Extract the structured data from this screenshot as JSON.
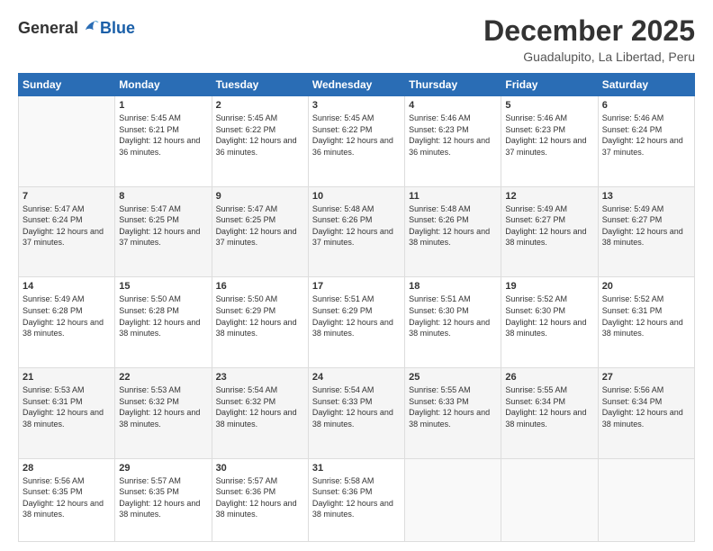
{
  "logo": {
    "general": "General",
    "blue": "Blue"
  },
  "header": {
    "title": "December 2025",
    "subtitle": "Guadalupito, La Libertad, Peru"
  },
  "days_of_week": [
    "Sunday",
    "Monday",
    "Tuesday",
    "Wednesday",
    "Thursday",
    "Friday",
    "Saturday"
  ],
  "weeks": [
    [
      {
        "day": "",
        "sunrise": "",
        "sunset": "",
        "daylight": ""
      },
      {
        "day": "1",
        "sunrise": "Sunrise: 5:45 AM",
        "sunset": "Sunset: 6:21 PM",
        "daylight": "Daylight: 12 hours and 36 minutes."
      },
      {
        "day": "2",
        "sunrise": "Sunrise: 5:45 AM",
        "sunset": "Sunset: 6:22 PM",
        "daylight": "Daylight: 12 hours and 36 minutes."
      },
      {
        "day": "3",
        "sunrise": "Sunrise: 5:45 AM",
        "sunset": "Sunset: 6:22 PM",
        "daylight": "Daylight: 12 hours and 36 minutes."
      },
      {
        "day": "4",
        "sunrise": "Sunrise: 5:46 AM",
        "sunset": "Sunset: 6:23 PM",
        "daylight": "Daylight: 12 hours and 36 minutes."
      },
      {
        "day": "5",
        "sunrise": "Sunrise: 5:46 AM",
        "sunset": "Sunset: 6:23 PM",
        "daylight": "Daylight: 12 hours and 37 minutes."
      },
      {
        "day": "6",
        "sunrise": "Sunrise: 5:46 AM",
        "sunset": "Sunset: 6:24 PM",
        "daylight": "Daylight: 12 hours and 37 minutes."
      }
    ],
    [
      {
        "day": "7",
        "sunrise": "Sunrise: 5:47 AM",
        "sunset": "Sunset: 6:24 PM",
        "daylight": "Daylight: 12 hours and 37 minutes."
      },
      {
        "day": "8",
        "sunrise": "Sunrise: 5:47 AM",
        "sunset": "Sunset: 6:25 PM",
        "daylight": "Daylight: 12 hours and 37 minutes."
      },
      {
        "day": "9",
        "sunrise": "Sunrise: 5:47 AM",
        "sunset": "Sunset: 6:25 PM",
        "daylight": "Daylight: 12 hours and 37 minutes."
      },
      {
        "day": "10",
        "sunrise": "Sunrise: 5:48 AM",
        "sunset": "Sunset: 6:26 PM",
        "daylight": "Daylight: 12 hours and 37 minutes."
      },
      {
        "day": "11",
        "sunrise": "Sunrise: 5:48 AM",
        "sunset": "Sunset: 6:26 PM",
        "daylight": "Daylight: 12 hours and 38 minutes."
      },
      {
        "day": "12",
        "sunrise": "Sunrise: 5:49 AM",
        "sunset": "Sunset: 6:27 PM",
        "daylight": "Daylight: 12 hours and 38 minutes."
      },
      {
        "day": "13",
        "sunrise": "Sunrise: 5:49 AM",
        "sunset": "Sunset: 6:27 PM",
        "daylight": "Daylight: 12 hours and 38 minutes."
      }
    ],
    [
      {
        "day": "14",
        "sunrise": "Sunrise: 5:49 AM",
        "sunset": "Sunset: 6:28 PM",
        "daylight": "Daylight: 12 hours and 38 minutes."
      },
      {
        "day": "15",
        "sunrise": "Sunrise: 5:50 AM",
        "sunset": "Sunset: 6:28 PM",
        "daylight": "Daylight: 12 hours and 38 minutes."
      },
      {
        "day": "16",
        "sunrise": "Sunrise: 5:50 AM",
        "sunset": "Sunset: 6:29 PM",
        "daylight": "Daylight: 12 hours and 38 minutes."
      },
      {
        "day": "17",
        "sunrise": "Sunrise: 5:51 AM",
        "sunset": "Sunset: 6:29 PM",
        "daylight": "Daylight: 12 hours and 38 minutes."
      },
      {
        "day": "18",
        "sunrise": "Sunrise: 5:51 AM",
        "sunset": "Sunset: 6:30 PM",
        "daylight": "Daylight: 12 hours and 38 minutes."
      },
      {
        "day": "19",
        "sunrise": "Sunrise: 5:52 AM",
        "sunset": "Sunset: 6:30 PM",
        "daylight": "Daylight: 12 hours and 38 minutes."
      },
      {
        "day": "20",
        "sunrise": "Sunrise: 5:52 AM",
        "sunset": "Sunset: 6:31 PM",
        "daylight": "Daylight: 12 hours and 38 minutes."
      }
    ],
    [
      {
        "day": "21",
        "sunrise": "Sunrise: 5:53 AM",
        "sunset": "Sunset: 6:31 PM",
        "daylight": "Daylight: 12 hours and 38 minutes."
      },
      {
        "day": "22",
        "sunrise": "Sunrise: 5:53 AM",
        "sunset": "Sunset: 6:32 PM",
        "daylight": "Daylight: 12 hours and 38 minutes."
      },
      {
        "day": "23",
        "sunrise": "Sunrise: 5:54 AM",
        "sunset": "Sunset: 6:32 PM",
        "daylight": "Daylight: 12 hours and 38 minutes."
      },
      {
        "day": "24",
        "sunrise": "Sunrise: 5:54 AM",
        "sunset": "Sunset: 6:33 PM",
        "daylight": "Daylight: 12 hours and 38 minutes."
      },
      {
        "day": "25",
        "sunrise": "Sunrise: 5:55 AM",
        "sunset": "Sunset: 6:33 PM",
        "daylight": "Daylight: 12 hours and 38 minutes."
      },
      {
        "day": "26",
        "sunrise": "Sunrise: 5:55 AM",
        "sunset": "Sunset: 6:34 PM",
        "daylight": "Daylight: 12 hours and 38 minutes."
      },
      {
        "day": "27",
        "sunrise": "Sunrise: 5:56 AM",
        "sunset": "Sunset: 6:34 PM",
        "daylight": "Daylight: 12 hours and 38 minutes."
      }
    ],
    [
      {
        "day": "28",
        "sunrise": "Sunrise: 5:56 AM",
        "sunset": "Sunset: 6:35 PM",
        "daylight": "Daylight: 12 hours and 38 minutes."
      },
      {
        "day": "29",
        "sunrise": "Sunrise: 5:57 AM",
        "sunset": "Sunset: 6:35 PM",
        "daylight": "Daylight: 12 hours and 38 minutes."
      },
      {
        "day": "30",
        "sunrise": "Sunrise: 5:57 AM",
        "sunset": "Sunset: 6:36 PM",
        "daylight": "Daylight: 12 hours and 38 minutes."
      },
      {
        "day": "31",
        "sunrise": "Sunrise: 5:58 AM",
        "sunset": "Sunset: 6:36 PM",
        "daylight": "Daylight: 12 hours and 38 minutes."
      },
      {
        "day": "",
        "sunrise": "",
        "sunset": "",
        "daylight": ""
      },
      {
        "day": "",
        "sunrise": "",
        "sunset": "",
        "daylight": ""
      },
      {
        "day": "",
        "sunrise": "",
        "sunset": "",
        "daylight": ""
      }
    ]
  ]
}
